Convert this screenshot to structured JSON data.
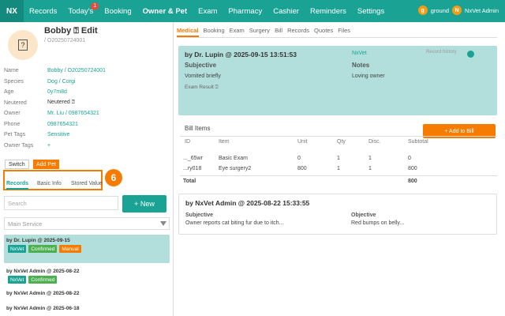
{
  "nav": {
    "logo": "NX",
    "items": [
      "Records",
      "Today's",
      "Booking",
      "Owner & Pet",
      "Exam",
      "Pharmacy",
      "Cashier",
      "Reminders",
      "Settings"
    ],
    "badge": "1",
    "user_initial": "g",
    "user_short": "ground",
    "user_initial2": "N",
    "user_name": "NxVet Admin"
  },
  "pet": {
    "name": "Bobby ⍰ Edit",
    "id": "/ O20250724001",
    "photo_glyph": "?",
    "fields": [
      {
        "k": "Name",
        "v": "Bobby / O20250724001"
      },
      {
        "k": "Species",
        "v": "Dog / Corgi"
      },
      {
        "k": "Age",
        "v": "0y7m8d"
      },
      {
        "k": "Neutered",
        "v": "Neutered ⍰"
      },
      {
        "k": "Owner",
        "v": "Mr. Liu / 0987654321"
      },
      {
        "k": "Phone",
        "v": "0987654321"
      },
      {
        "k": "Pet Tags",
        "v": "Sensitive"
      },
      {
        "k": "Owner Tags",
        "v": "+"
      }
    ]
  },
  "left": {
    "switch": "Switch",
    "add_pet": "Add Pet",
    "subtabs": [
      "Records",
      "Basic Info",
      "Stored Value"
    ],
    "step_badge": "6",
    "search_placeholder": "Search",
    "new_button": "+ New",
    "service_select": "Main Service",
    "visits": [
      {
        "title": "by Dr. Lupin @ 2025-09-15",
        "tags": [
          "NxVet",
          "Confirmed",
          "Manual"
        ]
      },
      {
        "title": "by NxVet Admin @ 2025-08-22",
        "tags": [
          "NxVet",
          "Confirmed"
        ]
      },
      {
        "title": "by NxVet Admin @ 2025-08-22",
        "tags": []
      },
      {
        "title": "by NxVet Admin @ 2025-06-18",
        "tags": []
      }
    ]
  },
  "main": {
    "tabs": [
      "Medical",
      "Booking",
      "Exam",
      "Surgery",
      "Bill",
      "Records",
      "Quotes",
      "Files"
    ],
    "record1": {
      "header": "by Dr. Lupin @ 2025-09-15 13:51:53",
      "vet": "NxVet",
      "history_label": "Record history",
      "subjective_label": "Subjective",
      "subjective": "Vomited briefly",
      "notes_label": "Notes",
      "notes": "Loving owner",
      "exam_result": "Exam Result ⍰"
    },
    "bill": {
      "title": "Bill Items",
      "add_button": "+ Add to Bill",
      "columns": [
        "ID",
        "Item",
        "Unit",
        "Qty",
        "Disc.",
        "Subtotal"
      ],
      "rows": [
        [
          "..._65wr",
          "Basic Exam",
          "0",
          "1",
          "1",
          "0"
        ],
        [
          "...ry018",
          "Eye surgery2",
          "800",
          "1",
          "1",
          "800"
        ]
      ],
      "total_label": "Total",
      "total": "800"
    },
    "record2": {
      "header": "by NxVet Admin @ 2025-08-22 15:33:55",
      "subjective_label": "Subjective",
      "subjective": "Owner reports cat biting fur due to itch...",
      "objective_label": "Objective",
      "objective": "Red bumps on belly..."
    }
  },
  "colors": {
    "teal": "#1aa394",
    "orange": "#f57c00",
    "green": "#4caf50",
    "card": "#b2dfdc"
  }
}
